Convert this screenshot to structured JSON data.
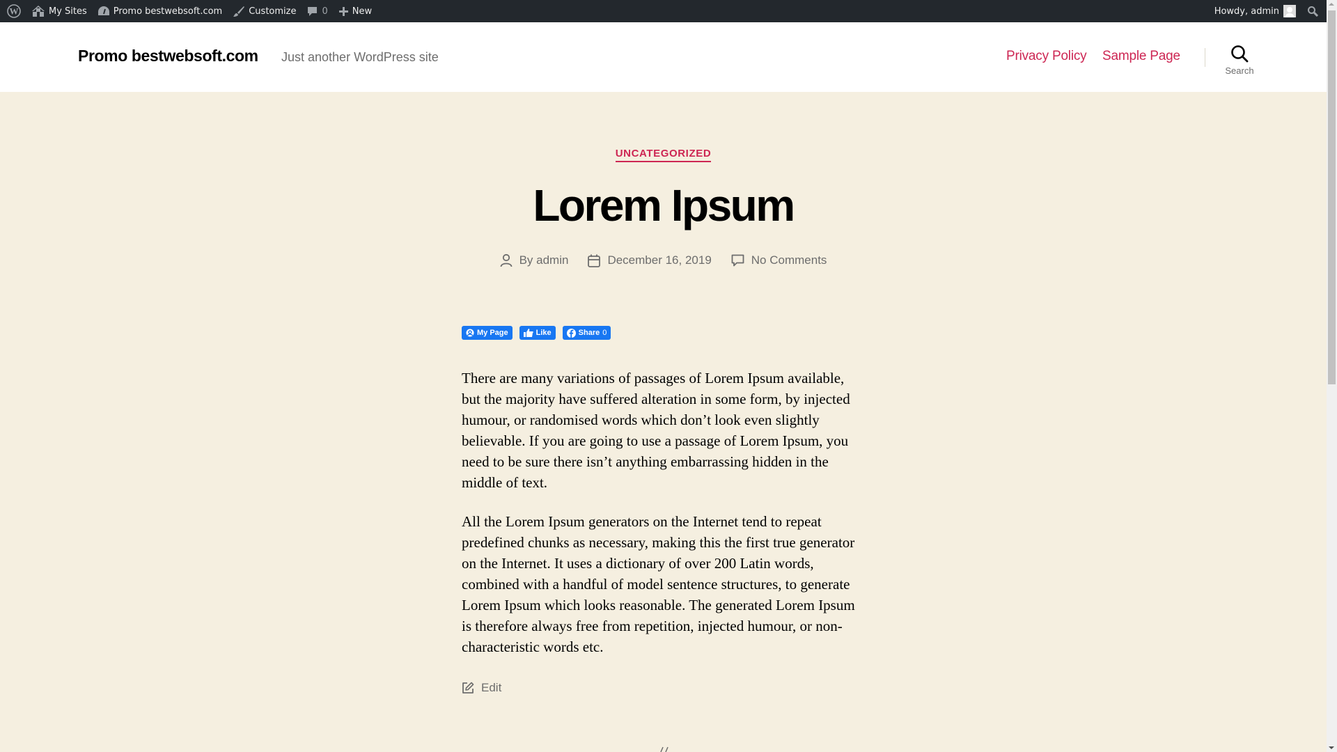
{
  "adminbar": {
    "wp_logo": "wordpress-logo-icon",
    "my_sites": "My Sites",
    "site_name": "Promo bestwebsoft.com",
    "customize": "Customize",
    "comments_count": "0",
    "new": "New",
    "howdy": "Howdy, admin"
  },
  "header": {
    "site_title": "Promo bestwebsoft.com",
    "site_description": "Just another WordPress site",
    "nav": [
      {
        "label": "Privacy Policy"
      },
      {
        "label": "Sample Page"
      }
    ],
    "search_label": "Search"
  },
  "post": {
    "category": "UNCATEGORIZED",
    "title": "Lorem Ipsum",
    "author_prefix": "By ",
    "author": "admin",
    "date": "December 16, 2019",
    "comments": "No Comments",
    "social": {
      "my_page": "My Page",
      "like": "Like",
      "share": "Share",
      "share_count": "0"
    },
    "paragraphs": [
      "There are many variations of passages of Lorem Ipsum available, but the majority have suffered alteration in some form, by injected humour, or randomised words which don’t look even slightly believable. If you are going to use a passage of Lorem Ipsum, you need to be sure there isn’t anything embarrassing hidden in the middle of text.",
      "All the Lorem Ipsum generators on the Internet tend to repeat predefined chunks as necessary, making this the first true generator on the Internet. It uses a dictionary of over 200 Latin words, combined with a handful of model sentence structures, to generate Lorem Ipsum which looks reasonable. The generated Lorem Ipsum is therefore always free from repetition, injected humour, or non-characteristic words etc."
    ],
    "edit": "Edit"
  },
  "colors": {
    "accent": "#cd2653",
    "background": "#f5efe0",
    "adminbar": "#23282d",
    "facebook": "#1877f2"
  }
}
